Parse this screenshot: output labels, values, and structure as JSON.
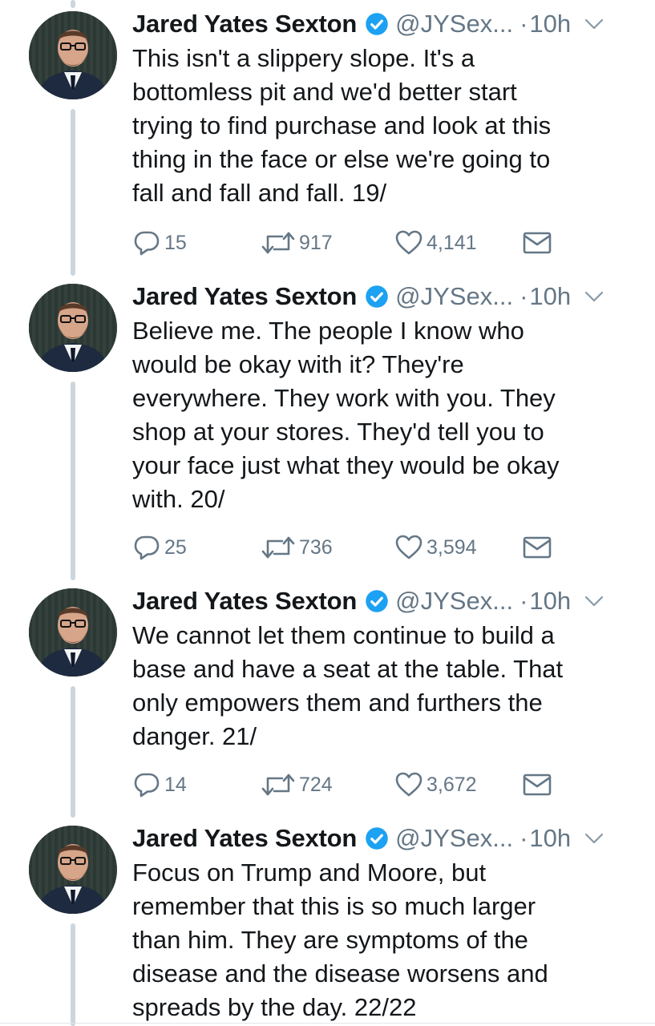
{
  "colors": {
    "text": "#14171a",
    "secondary": "#657786",
    "verified": "#1da1f2",
    "thread_line": "#ccd6dd"
  },
  "icons": {
    "reply": "reply-icon",
    "retweet": "retweet-icon",
    "like": "heart-icon",
    "dm": "envelope-icon",
    "verified": "verified-badge-icon",
    "menu": "chevron-down-icon"
  },
  "tweets": [
    {
      "author": "Jared Yates Sexton",
      "handle": "@JYSex...",
      "separator": "·",
      "time": "10h",
      "text": "This isn't a slippery slope. It's a\nbottomless pit and we'd better start\ntrying to find purchase and look at this\nthing in the face or else we're going to\nfall and fall and fall. 19/",
      "replies": "15",
      "retweets": "917",
      "likes": "4,141"
    },
    {
      "author": "Jared Yates Sexton",
      "handle": "@JYSex...",
      "separator": "·",
      "time": "10h",
      "text": "Believe me. The people I know who\nwould be okay with it? They're\neverywhere. They work with you. They\nshop at your stores. They'd tell you to\nyour face just what they would be okay\nwith. 20/",
      "replies": "25",
      "retweets": "736",
      "likes": "3,594"
    },
    {
      "author": "Jared Yates Sexton",
      "handle": "@JYSex...",
      "separator": "·",
      "time": "10h",
      "text": "We cannot let them continue to build a\nbase and have a seat at the table. That\nonly empowers them and furthers the\ndanger. 21/",
      "replies": "14",
      "retweets": "724",
      "likes": "3,672"
    },
    {
      "author": "Jared Yates Sexton",
      "handle": "@JYSex...",
      "separator": "·",
      "time": "10h",
      "text": "Focus on Trump and Moore, but\nremember that this is so much larger\nthan him. They are symptoms of the\ndisease and the disease worsens and\nspreads by the day. 22/22"
    }
  ]
}
